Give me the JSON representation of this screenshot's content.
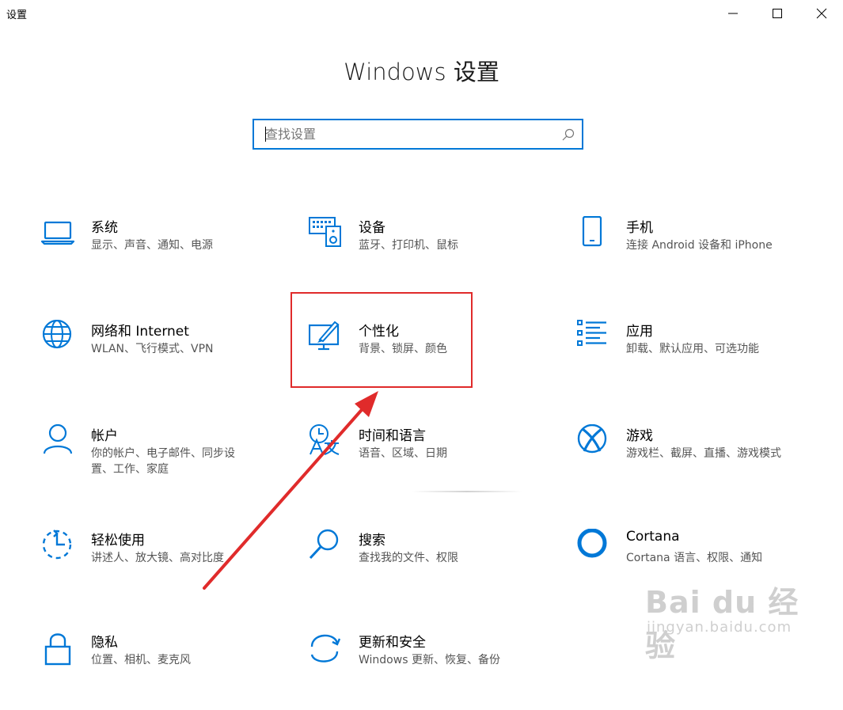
{
  "window": {
    "title": "设置",
    "controls": [
      "minimize-icon",
      "maximize-icon",
      "close-icon"
    ]
  },
  "heading": "Windows 设置",
  "search": {
    "placeholder": "查找设置",
    "icon": "search-icon"
  },
  "tiles": [
    {
      "title": "系统",
      "desc": "显示、声音、通知、电源",
      "icon": "laptop-icon"
    },
    {
      "title": "设备",
      "desc": "蓝牙、打印机、鼠标",
      "icon": "keyboard-speaker-icon"
    },
    {
      "title": "手机",
      "desc": "连接 Android 设备和 iPhone",
      "icon": "phone-icon"
    },
    {
      "title": "网络和 Internet",
      "desc": "WLAN、飞行模式、VPN",
      "icon": "globe-icon"
    },
    {
      "title": "个性化",
      "desc": "背景、锁屏、颜色",
      "icon": "paint-monitor-icon"
    },
    {
      "title": "应用",
      "desc": "卸载、默认应用、可选功能",
      "icon": "apps-list-icon"
    },
    {
      "title": "帐户",
      "desc": "你的帐户、电子邮件、同步设置、工作、家庭",
      "icon": "person-icon"
    },
    {
      "title": "时间和语言",
      "desc": "语音、区域、日期",
      "icon": "time-language-icon"
    },
    {
      "title": "游戏",
      "desc": "游戏栏、截屏、直播、游戏模式",
      "icon": "xbox-icon"
    },
    {
      "title": "轻松使用",
      "desc": "讲述人、放大镜、高对比度",
      "icon": "ease-of-access-icon"
    },
    {
      "title": "搜索",
      "desc": "查找我的文件、权限",
      "icon": "search-magnifier-icon"
    },
    {
      "title": "Cortana",
      "desc": "Cortana 语言、权限、通知",
      "icon": "cortana-icon"
    },
    {
      "title": "隐私",
      "desc": "位置、相机、麦克风",
      "icon": "lock-icon"
    },
    {
      "title": "更新和安全",
      "desc": "Windows 更新、恢复、备份",
      "icon": "update-icon"
    }
  ],
  "annotation": {
    "box_color": "#e02b2b",
    "arrow_color": "#e02b2b",
    "target": "个性化"
  },
  "accent_color": "#0078d7",
  "watermark": {
    "brand": "Bai du 经验",
    "url": "jingyan.baidu.com"
  }
}
